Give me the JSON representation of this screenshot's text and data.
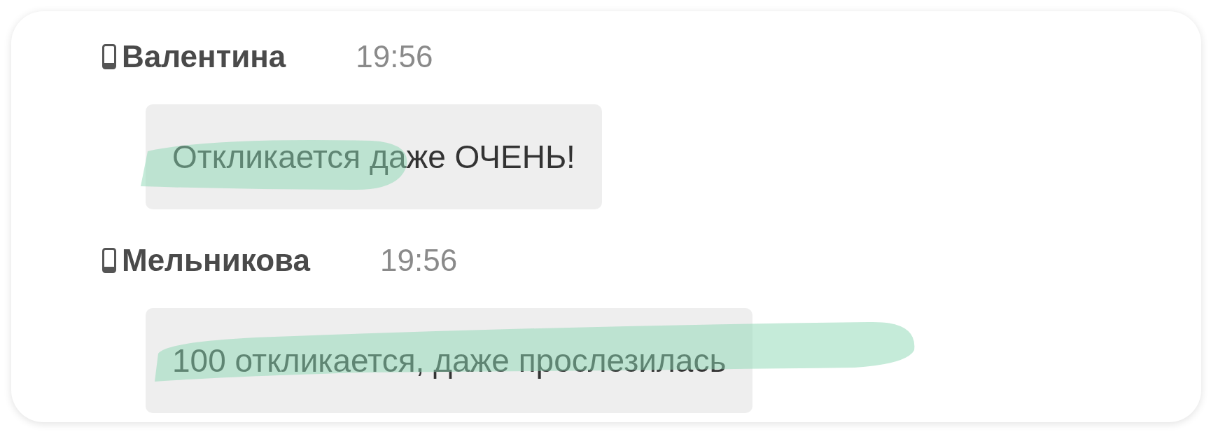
{
  "messages": [
    {
      "sender": "Валентина",
      "time": "19:56",
      "text": "Откликается даже ОЧЕНЬ!"
    },
    {
      "sender": "Мельникова",
      "time": "19:56",
      "text": "100 откликается, даже прослезилась"
    }
  ]
}
